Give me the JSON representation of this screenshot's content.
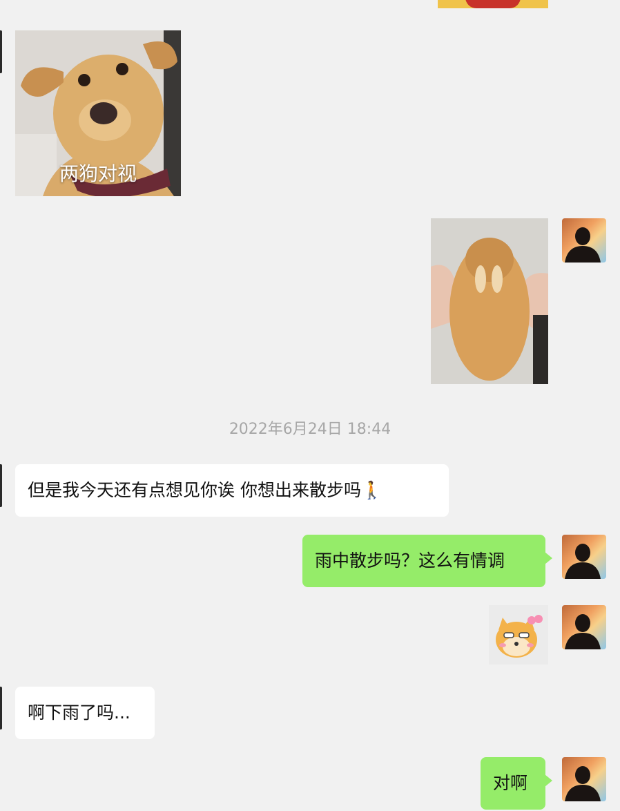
{
  "chat": {
    "timestamp": "2022年6月24日 18:44",
    "messages": [
      {
        "side": "left",
        "type": "sticker",
        "caption": "两狗对视"
      },
      {
        "side": "right",
        "type": "image",
        "icon": "rabbit-photo"
      },
      {
        "side": "left",
        "type": "text",
        "text": "但是我今天还有点想见你诶 你想出来散步吗🚶"
      },
      {
        "side": "right",
        "type": "text",
        "text": "雨中散步吗？这么有情调"
      },
      {
        "side": "right",
        "type": "sticker",
        "icon": "shiba-emoji"
      },
      {
        "side": "left",
        "type": "text",
        "text": "啊下雨了吗..."
      },
      {
        "side": "right",
        "type": "text",
        "text": "对啊"
      }
    ]
  },
  "colors": {
    "background": "#f1f1f1",
    "bubble_self": "#95ec69",
    "bubble_other": "#ffffff",
    "timestamp": "#a7a7a7"
  }
}
